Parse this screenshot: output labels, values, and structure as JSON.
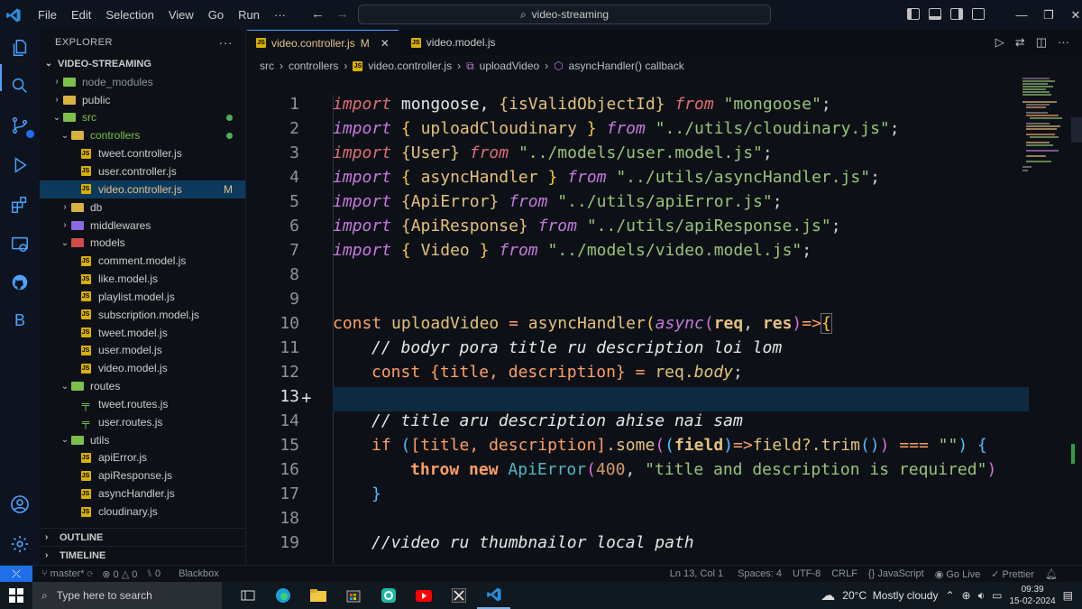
{
  "titlebar": {
    "menu": [
      "File",
      "Edit",
      "Selection",
      "View",
      "Go",
      "Run",
      "···"
    ],
    "search": "video-streaming"
  },
  "explorer": {
    "title": "EXPLORER",
    "root": "VIDEO-STREAMING",
    "items": [
      {
        "label": "node_modules",
        "depth": 1,
        "type": "folder",
        "color": "green",
        "open": false,
        "dim": true
      },
      {
        "label": "public",
        "depth": 1,
        "type": "folder",
        "color": "yellow",
        "open": false
      },
      {
        "label": "src",
        "depth": 1,
        "type": "folder",
        "color": "green",
        "open": true,
        "dot": true
      },
      {
        "label": "controllers",
        "depth": 2,
        "type": "folder",
        "color": "yellow",
        "open": true,
        "dot": true
      },
      {
        "label": "tweet.controller.js",
        "depth": 3,
        "type": "js"
      },
      {
        "label": "user.controller.js",
        "depth": 3,
        "type": "js"
      },
      {
        "label": "video.controller.js",
        "depth": 3,
        "type": "js",
        "selected": true,
        "mod": "M"
      },
      {
        "label": "db",
        "depth": 2,
        "type": "folder",
        "color": "yellow",
        "open": false
      },
      {
        "label": "middlewares",
        "depth": 2,
        "type": "folder",
        "color": "purple",
        "open": false
      },
      {
        "label": "models",
        "depth": 2,
        "type": "folder",
        "color": "red",
        "open": true
      },
      {
        "label": "comment.model.js",
        "depth": 3,
        "type": "js"
      },
      {
        "label": "like.model.js",
        "depth": 3,
        "type": "js"
      },
      {
        "label": "playlist.model.js",
        "depth": 3,
        "type": "js"
      },
      {
        "label": "subscription.model.js",
        "depth": 3,
        "type": "js"
      },
      {
        "label": "tweet.model.js",
        "depth": 3,
        "type": "js"
      },
      {
        "label": "user.model.js",
        "depth": 3,
        "type": "js"
      },
      {
        "label": "video.model.js",
        "depth": 3,
        "type": "js"
      },
      {
        "label": "routes",
        "depth": 2,
        "type": "folder",
        "color": "green",
        "open": true
      },
      {
        "label": "tweet.routes.js",
        "depth": 3,
        "type": "route"
      },
      {
        "label": "user.routes.js",
        "depth": 3,
        "type": "route"
      },
      {
        "label": "utils",
        "depth": 2,
        "type": "folder",
        "color": "green",
        "open": true
      },
      {
        "label": "apiError.js",
        "depth": 3,
        "type": "js"
      },
      {
        "label": "apiResponse.js",
        "depth": 3,
        "type": "js"
      },
      {
        "label": "asyncHandler.js",
        "depth": 3,
        "type": "js"
      },
      {
        "label": "cloudinary.js",
        "depth": 3,
        "type": "js"
      }
    ],
    "outline": "OUTLINE",
    "timeline": "TIMELINE"
  },
  "tabs": [
    {
      "label": "video.controller.js",
      "mod": "M",
      "active": true
    },
    {
      "label": "video.model.js",
      "active": false
    }
  ],
  "breadcrumb": [
    "src",
    "controllers",
    "video.controller.js",
    "uploadVideo",
    "asyncHandler() callback"
  ],
  "code": {
    "current_line": 13,
    "lines": [
      {
        "n": "1"
      },
      {
        "n": "2"
      },
      {
        "n": "3"
      },
      {
        "n": "4"
      },
      {
        "n": "5"
      },
      {
        "n": "6"
      },
      {
        "n": "7"
      },
      {
        "n": "8"
      },
      {
        "n": "9"
      },
      {
        "n": "10"
      },
      {
        "n": "11"
      },
      {
        "n": "12"
      },
      {
        "n": "13"
      },
      {
        "n": "14"
      },
      {
        "n": "15"
      },
      {
        "n": "16"
      },
      {
        "n": "17"
      },
      {
        "n": "18"
      },
      {
        "n": "19"
      }
    ],
    "l1": [
      "import",
      "mongoose,",
      "{isValidObjectId}",
      "from",
      "\"mongoose\"",
      ";"
    ],
    "l2": [
      "import",
      "{",
      "uploadCloudinary",
      "}",
      "from",
      "\"../utils/cloudinary.js\"",
      ";"
    ],
    "l3": [
      "import",
      "{User}",
      "from",
      "\"../models/user.model.js\"",
      ";"
    ],
    "l4": [
      "import",
      "{",
      "asyncHandler",
      "}",
      "from",
      "\"../utils/asyncHandler.js\"",
      ";"
    ],
    "l5": [
      "import",
      "{ApiError}",
      "from",
      "\"../utils/apiError.js\"",
      ";"
    ],
    "l6": [
      "import",
      "{ApiResponse}",
      "from",
      "\"../utils/apiResponse.js\"",
      ";"
    ],
    "l7": [
      "import",
      "{",
      "Video",
      "}",
      "from",
      "\"../models/video.model.js\"",
      ";"
    ],
    "l10": [
      "const",
      "uploadVideo",
      "=",
      "asyncHandler",
      "(",
      "async",
      "(",
      "req",
      ",",
      "res",
      ")",
      "=>",
      "{"
    ],
    "l11": "// bodyr pora title ru description loi lom",
    "l12": [
      "const",
      "{title, description}",
      "=",
      "req.",
      "body",
      ";"
    ],
    "l14": "// title aru description ahise nai sam",
    "l15": [
      "if",
      "(",
      "[title, description]",
      ".some",
      "(",
      "(",
      "field",
      ")",
      "=>",
      "field?.",
      "trim",
      "()",
      ")",
      "===",
      "\"\"",
      ")",
      "{"
    ],
    "l16": [
      "throw",
      "new",
      "ApiError",
      "(",
      "400",
      ",",
      "\"title and description is required\"",
      ")"
    ],
    "l17": "}",
    "l19": "//video ru thumbnailor local path"
  },
  "status": {
    "branch": "master*",
    "errors": "0",
    "warnings": "0",
    "info": "0",
    "blackbox": "Blackbox",
    "position": "Ln 13, Col 1",
    "spaces": "Spaces: 4",
    "encoding": "UTF-8",
    "eol": "CRLF",
    "language": "JavaScript",
    "golive": "Go Live",
    "prettier": "Prettier"
  },
  "taskbar": {
    "search_placeholder": "Type here to search",
    "weather": "20°C  Mostly cloudy",
    "time": "09:39",
    "date": "15-02-2024"
  }
}
